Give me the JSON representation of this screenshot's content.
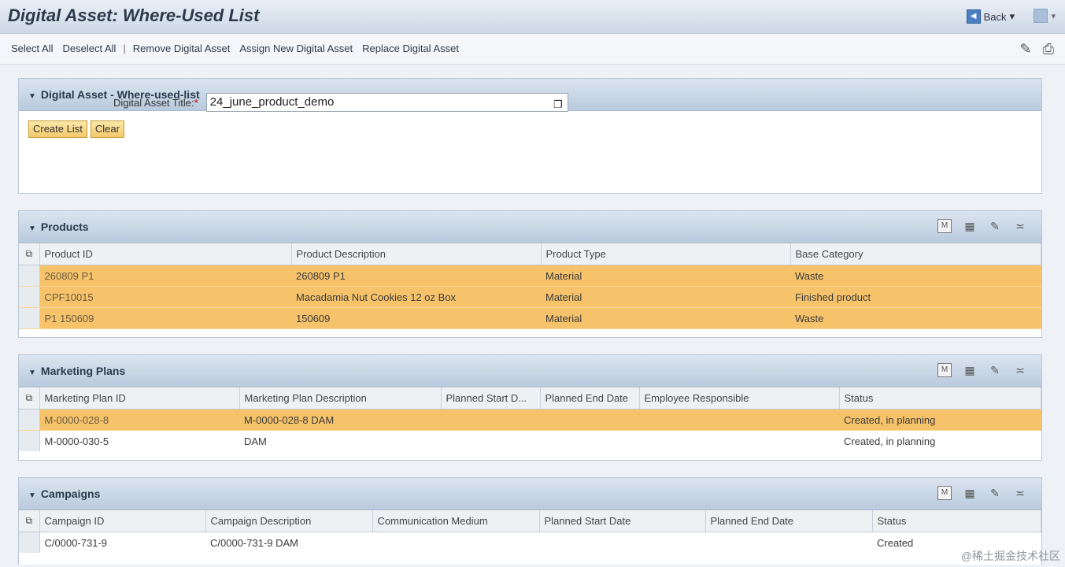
{
  "window": {
    "title": "Digital Asset: Where-Used List",
    "back_label": "Back"
  },
  "toolbar": {
    "items": [
      "Select All",
      "Deselect All",
      "Remove Digital Asset",
      "Assign New Digital Asset",
      "Replace Digital Asset"
    ],
    "icons": [
      "pencil-icon",
      "print-icon"
    ]
  },
  "search_panel": {
    "title": "Digital Asset - Where-used-list",
    "field_label": "Digital Asset Title:",
    "required_mark": "*",
    "field_value": "24_june_product_demo",
    "create_button": "Create List",
    "clear_button": "Clear"
  },
  "products": {
    "title": "Products",
    "columns": [
      "Product ID",
      "Product Description",
      "Product Type",
      "Base Category"
    ],
    "rows": [
      {
        "id": "260809 P1",
        "desc": "260809 P1",
        "type": "Material",
        "cat": "Waste"
      },
      {
        "id": "CPF10015",
        "desc": "Macadamia Nut Cookies 12 oz Box",
        "type": "Material",
        "cat": "Finished product"
      },
      {
        "id": "P1 150609",
        "desc": "150609",
        "type": "Material",
        "cat": "Waste"
      }
    ]
  },
  "marketing_plans": {
    "title": "Marketing Plans",
    "columns": [
      "Marketing Plan ID",
      "Marketing Plan Description",
      "Planned Start D...",
      "Planned End Date",
      "Employee Responsible",
      "Status"
    ],
    "rows": [
      {
        "id": "M-0000-028-8",
        "desc": "M-0000-028-8 DAM",
        "start": "",
        "end": "",
        "emp": "",
        "status": "Created, in planning"
      },
      {
        "id": "M-0000-030-5",
        "desc": "DAM",
        "start": "",
        "end": "",
        "emp": "",
        "status": "Created, in planning"
      }
    ]
  },
  "campaigns": {
    "title": "Campaigns",
    "columns": [
      "Campaign ID",
      "Campaign Description",
      "Communication Medium",
      "Planned Start Date",
      "Planned End Date",
      "Status"
    ],
    "rows": [
      {
        "id": "C/0000-731-9",
        "desc": "C/0000-731-9 DAM",
        "medium": "",
        "start": "",
        "end": "",
        "status": "Created"
      }
    ]
  },
  "watermark": "@稀土掘金技术社区"
}
